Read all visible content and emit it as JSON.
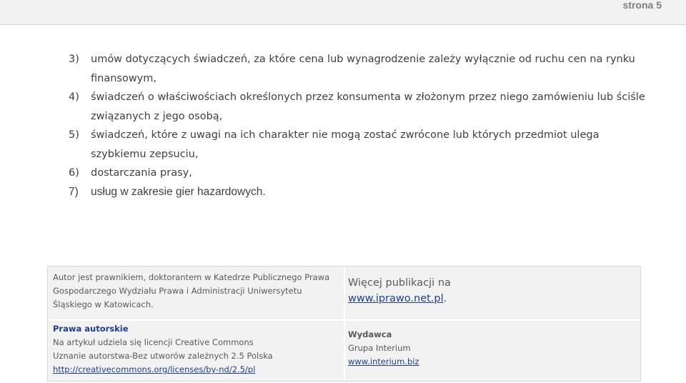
{
  "header": {
    "page_number": "strona 5"
  },
  "items": [
    {
      "number": "3)",
      "lines": [
        "umów dotyczących świadczeń, za które cena lub wynagrodzenie zależy wyłącznie od ruchu cen na rynku",
        "finansowym,"
      ]
    },
    {
      "number": "4)",
      "lines": [
        "świadczeń o właściwościach określonych przez konsumenta w złożonym przez niego zamówieniu lub ściśle",
        "związanych z jego osobą,"
      ]
    },
    {
      "number": "5)",
      "lines": [
        "świadczeń, które z uwagi na ich charakter nie mogą zostać zwrócone lub których przedmiot ulega",
        "szybkiemu zepsuciu,"
      ]
    },
    {
      "number": "6)",
      "lines": [
        "dostarczania prasy,"
      ]
    },
    {
      "number": "7)",
      "lines": [
        "usług w zakresie gier hazardowych."
      ]
    }
  ],
  "footer": {
    "author": {
      "lines": [
        "Autor jest prawnikiem, doktorantem w Katedrze  Publicznego Prawa",
        "Gospodarczego Wydziału Prawa i Administracji Uniwersytetu",
        "Śląskiego w Katowicach."
      ]
    },
    "more": {
      "text": "Więcej publikacji na",
      "link": "www.iprawo.net.pl",
      "suffix": "."
    },
    "license": {
      "heading": "Prawa autorskie",
      "line1": "Na artykuł udziela się licencji Creative Commons",
      "line2": "Uznanie autorstwa-Bez utworów zależnych 2.5 Polska",
      "link": "http://creativecommons.org/licenses/by-nd/2.5/pl"
    },
    "publisher": {
      "heading": "Wydawca",
      "name": "Grupa Interium",
      "link": "www.interium.biz"
    }
  }
}
